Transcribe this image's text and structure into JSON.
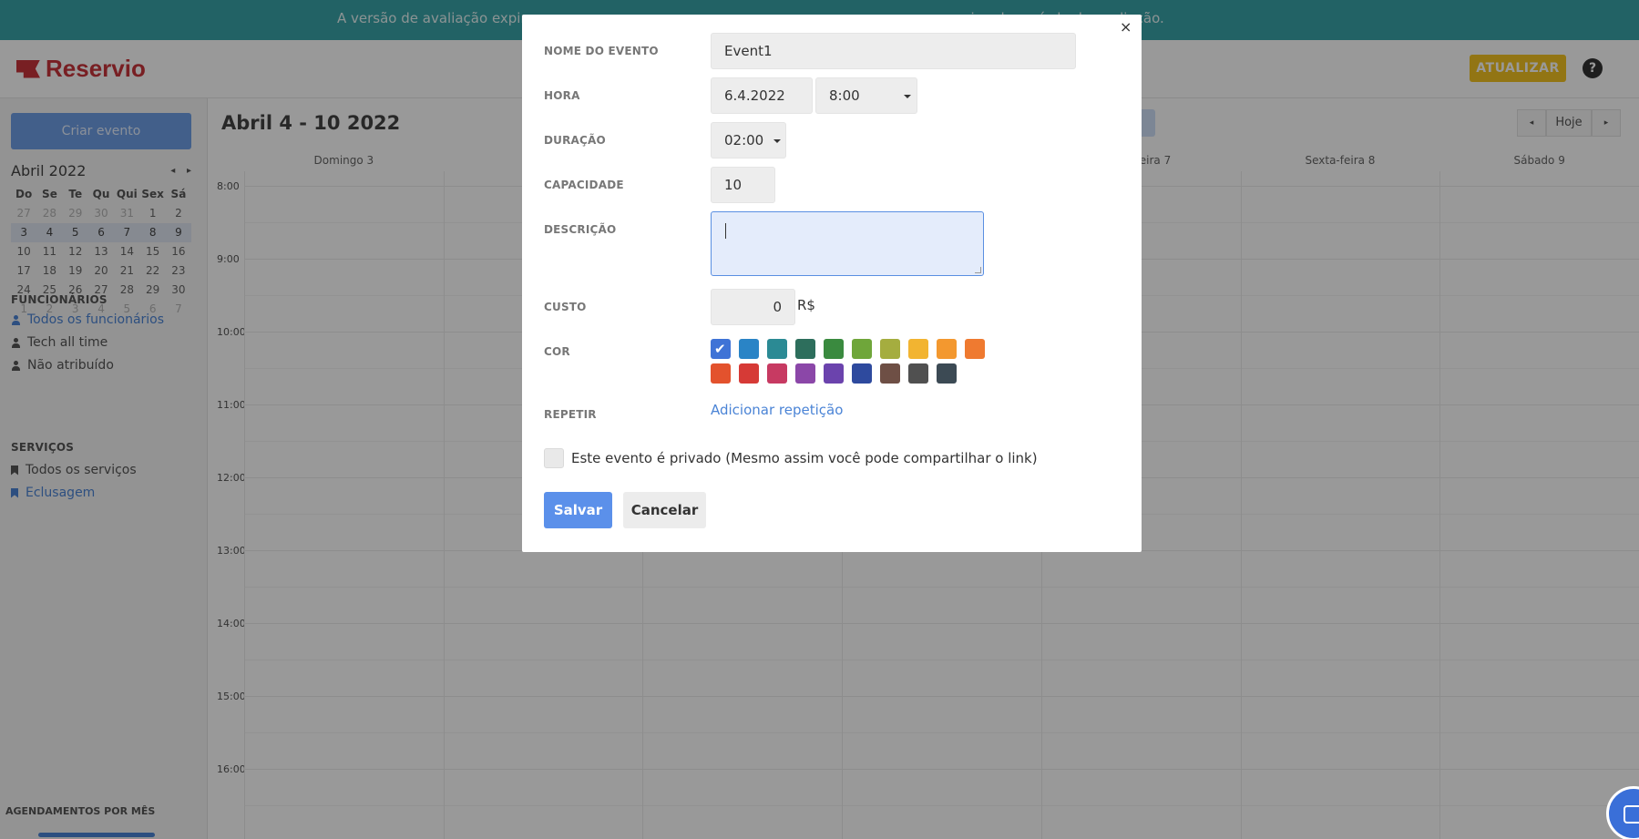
{
  "banner": {
    "text_left": "A versão de avaliação expira",
    "text_right": "rmino do período de avaliação."
  },
  "header": {
    "logo": "Reservio",
    "update_label": "ATUALIZAR",
    "help_glyph": "?"
  },
  "sidebar": {
    "create_label": "Criar evento",
    "calendar": {
      "month": "Abril 2022",
      "prev": "◂",
      "next": "▸",
      "weekdays": [
        "Do",
        "Se",
        "Te",
        "Qu",
        "Qui",
        "Sex",
        "Sá"
      ],
      "weeks": [
        [
          {
            "d": "27",
            "m": true
          },
          {
            "d": "28",
            "m": true
          },
          {
            "d": "29",
            "m": true
          },
          {
            "d": "30",
            "m": true
          },
          {
            "d": "31",
            "m": true
          },
          {
            "d": "1"
          },
          {
            "d": "2"
          }
        ],
        [
          {
            "d": "3",
            "s": true
          },
          {
            "d": "4",
            "s": true
          },
          {
            "d": "5",
            "s": true
          },
          {
            "d": "6",
            "s": true
          },
          {
            "d": "7",
            "s": true
          },
          {
            "d": "8",
            "s": true
          },
          {
            "d": "9",
            "s": true
          }
        ],
        [
          {
            "d": "10"
          },
          {
            "d": "11"
          },
          {
            "d": "12"
          },
          {
            "d": "13"
          },
          {
            "d": "14"
          },
          {
            "d": "15"
          },
          {
            "d": "16"
          }
        ],
        [
          {
            "d": "17"
          },
          {
            "d": "18"
          },
          {
            "d": "19"
          },
          {
            "d": "20"
          },
          {
            "d": "21"
          },
          {
            "d": "22"
          },
          {
            "d": "23"
          }
        ],
        [
          {
            "d": "24"
          },
          {
            "d": "25"
          },
          {
            "d": "26"
          },
          {
            "d": "27"
          },
          {
            "d": "28"
          },
          {
            "d": "29"
          },
          {
            "d": "30"
          }
        ],
        [
          {
            "d": "1",
            "m": true
          },
          {
            "d": "2",
            "m": true
          },
          {
            "d": "3",
            "m": true
          },
          {
            "d": "4",
            "m": true
          },
          {
            "d": "5",
            "m": true
          },
          {
            "d": "6",
            "m": true
          },
          {
            "d": "7",
            "m": true
          }
        ]
      ]
    },
    "employees_title": "FUNCIONÁRIOS",
    "employees": [
      "Todos os funcionários",
      "Tech all time",
      "Não atribuído"
    ],
    "services_title": "SERVIÇOS",
    "services": [
      "Todos os serviços",
      "Eclusagem"
    ],
    "stats_label": "AGENDAMENTOS POR MÊS"
  },
  "calendar_main": {
    "week_title": "Abril 4 - 10 2022",
    "today_label": "Hoje",
    "prev": "◂",
    "next": "▸",
    "day_headers": [
      "Domingo 3",
      "Se",
      "",
      "",
      "inta-feira 7",
      "Sexta-feira 8",
      "Sábado 9"
    ],
    "hours": [
      "8:00",
      "9:00",
      "10:00",
      "11:00",
      "12:00",
      "13:00",
      "14:00",
      "15:00",
      "16:00"
    ]
  },
  "modal": {
    "close_glyph": "×",
    "event_name_label": "NOME DO EVENTO",
    "event_name_value": "Event1",
    "time_label": "HORA",
    "date_value": "6.4.2022",
    "time_value": "8:00",
    "duration_label": "DURAÇÃO",
    "duration_value": "02:00",
    "capacity_label": "CAPACIDADE",
    "capacity_value": "10",
    "description_label": "DESCRIÇÃO",
    "description_value": "",
    "cost_label": "CUSTO",
    "cost_value": "0",
    "currency": "R$",
    "color_label": "COR",
    "colors": [
      "#3f73d6",
      "#2a84c6",
      "#2b8a94",
      "#2d6e5c",
      "#3a8a3f",
      "#6fa63a",
      "#a5ad3f",
      "#f2b431",
      "#f3982f",
      "#ef7a30",
      "#e3522d",
      "#d63a36",
      "#c73a62",
      "#8b47a8",
      "#6b43ad",
      "#2e4a9e",
      "#6e4f45",
      "#505050",
      "#3c4a54"
    ],
    "selected_color_index": 0,
    "repeat_label": "REPETIR",
    "repeat_link": "Adicionar repetição",
    "private_label": "Este evento é privado (Mesmo assim você pode compartilhar o link)",
    "save_label": "Salvar",
    "cancel_label": "Cancelar"
  }
}
